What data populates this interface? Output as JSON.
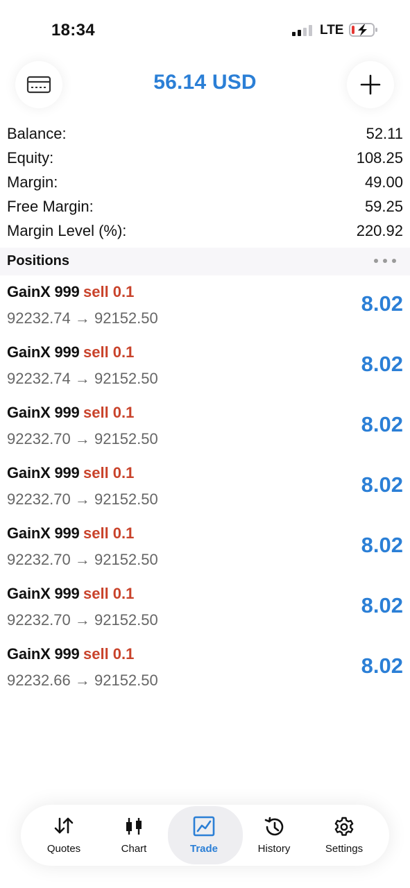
{
  "status_bar": {
    "time": "18:34",
    "network": "LTE"
  },
  "header": {
    "title": "56.14 USD"
  },
  "account": [
    {
      "label": "Balance:",
      "value": "52.11"
    },
    {
      "label": "Equity:",
      "value": "108.25"
    },
    {
      "label": "Margin:",
      "value": "49.00"
    },
    {
      "label": "Free Margin:",
      "value": "59.25"
    },
    {
      "label": "Margin Level (%):",
      "value": "220.92"
    }
  ],
  "positions": {
    "title": "Positions",
    "items": [
      {
        "symbol": "GainX 999",
        "side": "sell 0.1",
        "prices": "92232.74 → 92152.50",
        "profit": "8.02"
      },
      {
        "symbol": "GainX 999",
        "side": "sell 0.1",
        "prices": "92232.74 → 92152.50",
        "profit": "8.02"
      },
      {
        "symbol": "GainX 999",
        "side": "sell 0.1",
        "prices": "92232.70 → 92152.50",
        "profit": "8.02"
      },
      {
        "symbol": "GainX 999",
        "side": "sell 0.1",
        "prices": "92232.70 → 92152.50",
        "profit": "8.02"
      },
      {
        "symbol": "GainX 999",
        "side": "sell 0.1",
        "prices": "92232.70 → 92152.50",
        "profit": "8.02"
      },
      {
        "symbol": "GainX 999",
        "side": "sell 0.1",
        "prices": "92232.70 → 92152.50",
        "profit": "8.02"
      },
      {
        "symbol": "GainX 999",
        "side": "sell 0.1",
        "prices": "92232.66 → 92152.50",
        "profit": "8.02"
      }
    ]
  },
  "tabs": [
    {
      "label": "Quotes",
      "icon": "quotes-icon"
    },
    {
      "label": "Chart",
      "icon": "chart-icon"
    },
    {
      "label": "Trade",
      "icon": "trade-icon",
      "active": true
    },
    {
      "label": "History",
      "icon": "history-icon"
    },
    {
      "label": "Settings",
      "icon": "settings-icon"
    }
  ],
  "colors": {
    "accent": "#2b7fd6",
    "sell": "#c9432b",
    "muted": "#666666",
    "battery_low": "#e53935"
  }
}
